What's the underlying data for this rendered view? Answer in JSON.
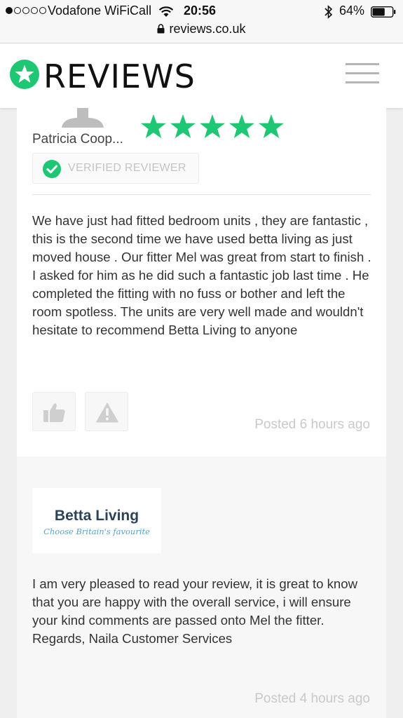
{
  "status_bar": {
    "carrier": "Vodafone WiFiCall",
    "time": "20:56",
    "battery": "64%",
    "url": "reviews.co.uk",
    "signal_dots_filled": 1,
    "signal_dots_total": 5,
    "battery_level": 0.64
  },
  "header": {
    "logo_text": "REVIEWS",
    "logo_icon": "star-icon",
    "menu_icon": "hamburger-icon",
    "brand_color": "#1ec773"
  },
  "review": {
    "reviewer_name": "Patricia Coop...",
    "rating": 5,
    "rating_max": 5,
    "verified_label": "VERIFIED REVIEWER",
    "body": "We have just had fitted bedroom units , they are fantastic , this is the second time we have used betta living as just moved house . Our fitter Mel was great from start to finish . I asked for him as he did such a fantastic job last time . He completed the fitting with no fuss or bother and left the room spotless. The units are very well made and wouldn't hesitate to recommend Betta Living to anyone",
    "posted": "Posted 6 hours ago",
    "helpful_icon": "thumbs-up-icon",
    "report_icon": "warning-icon"
  },
  "reply": {
    "company_name": "Betta Living",
    "company_tagline": "Choose Britain's favourite",
    "body": "I am very pleased to read your review, it is great to know that you are happy with the overall service, i will ensure your kind comments are passed onto Mel the fitter. Regards, Naila Customer Services",
    "posted": "Posted 4 hours ago"
  }
}
